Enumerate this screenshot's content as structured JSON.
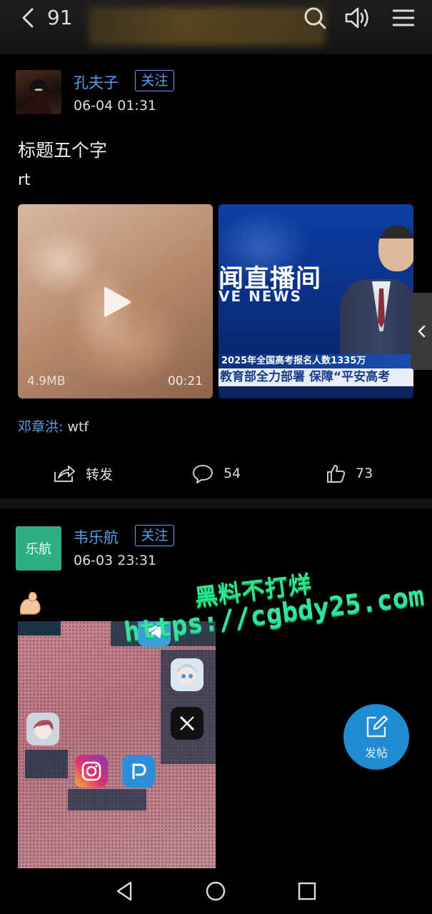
{
  "topbar": {
    "count": "91",
    "icons": [
      "back-icon",
      "search-icon",
      "speaker-icon",
      "menu-icon"
    ]
  },
  "posts": [
    {
      "username": "孔夫子",
      "follow_label": "关注",
      "time": "06-04 01:31",
      "title": "标题五个字",
      "body": "rt",
      "video": {
        "size": "4.9MB",
        "duration": "00:21"
      },
      "news_image": {
        "studio_text": "闻直播间",
        "english_text": "VE NEWS",
        "ticker_top": "2025年全国高考报名人数1335万",
        "ticker_main": "教育部全力部署 保障“平安高考"
      },
      "comment": {
        "user": "邓章洪:",
        "text": " wtf"
      },
      "actions": {
        "share_label": "转发",
        "comments": "54",
        "likes": "73"
      }
    },
    {
      "username": "韦乐航",
      "avatar_text": "乐航",
      "follow_label": "关注",
      "time": "06-03 23:31",
      "emoji": "flexed-biceps"
    }
  ],
  "watermark": {
    "line1": "黑料不打烊",
    "line2": "https://cgbdy25.com"
  },
  "fab": {
    "label": "发帖"
  },
  "colors": {
    "accent": "#5a9fe6",
    "fab": "#1f8bd0",
    "background": "#000000",
    "watermark": "#2ee58f"
  }
}
